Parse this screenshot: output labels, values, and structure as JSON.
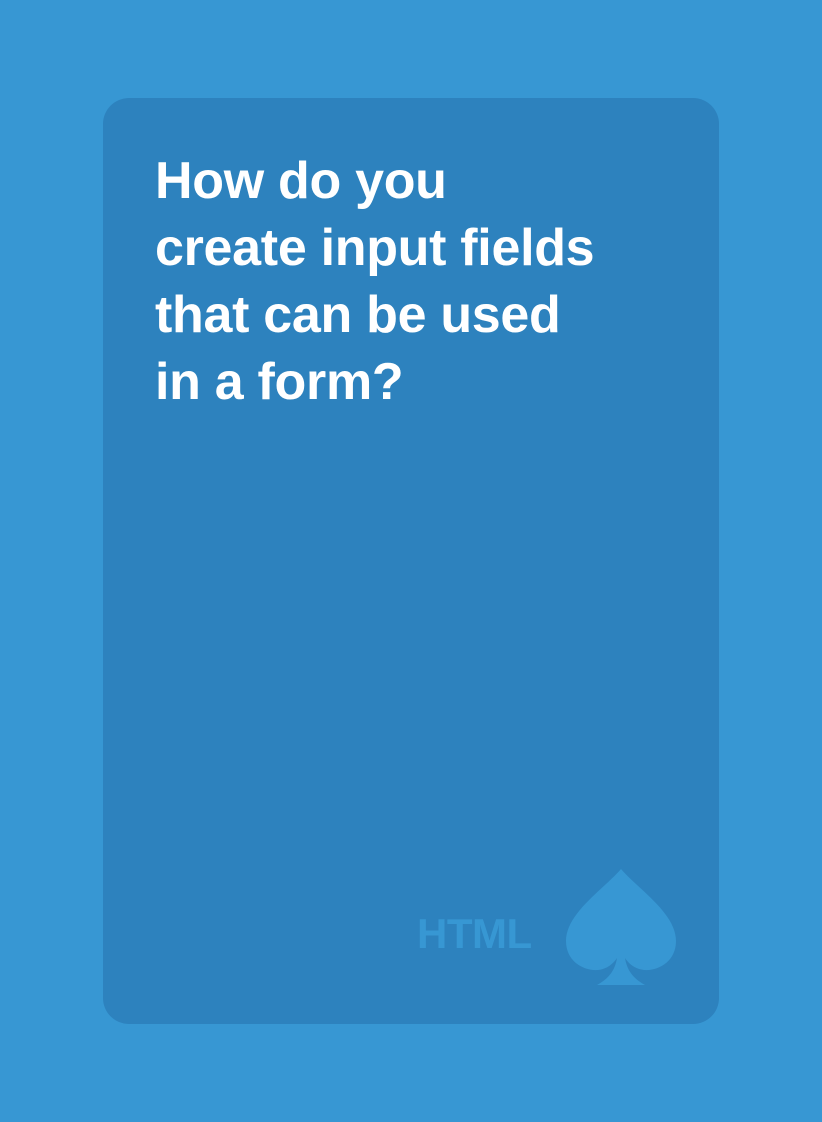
{
  "card": {
    "question_lines": [
      "How do you",
      "create input fields",
      "that can be used",
      "in a form?"
    ],
    "category": "HTML",
    "suit_icon": "spade-icon"
  },
  "colors": {
    "background": "#3797d3",
    "card": "#2d82be",
    "text": "#ffffff",
    "accent": "#3797d3"
  }
}
